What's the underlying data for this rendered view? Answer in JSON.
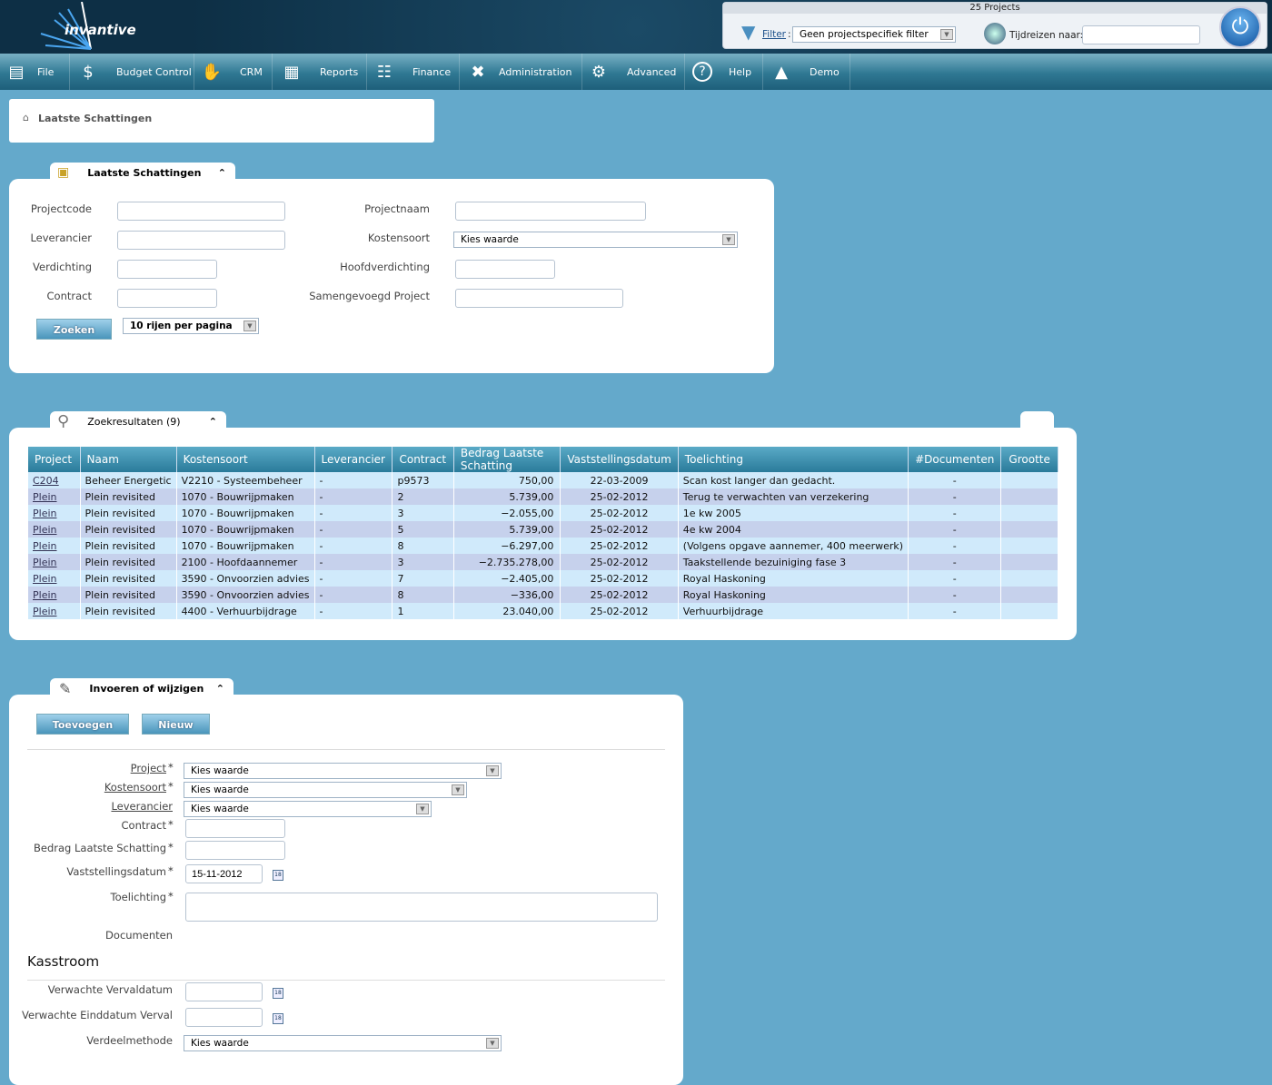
{
  "app": {
    "logo": "invantive",
    "colors": {
      "accent": "#2a7b9a",
      "background": "#64a9cb"
    }
  },
  "toppanel": {
    "projects_count": "25 Projects",
    "filter_label": "Filter",
    "filter_value": "Geen projectspecifiek filter",
    "timetravel_label": "Tijdreizen naar:",
    "timetravel_value": ""
  },
  "menu": [
    {
      "label": "File",
      "icon": "cabinet-icon"
    },
    {
      "label": "Budget Control",
      "icon": "money-bag-icon"
    },
    {
      "label": "CRM",
      "icon": "handshake-icon"
    },
    {
      "label": "Reports",
      "icon": "presentation-icon"
    },
    {
      "label": "Finance",
      "icon": "calculator-icon"
    },
    {
      "label": "Administration",
      "icon": "tools-icon"
    },
    {
      "label": "Advanced",
      "icon": "gears-icon"
    },
    {
      "label": "Help",
      "icon": "help-icon"
    },
    {
      "label": "Demo",
      "icon": "demo-icon"
    }
  ],
  "breadcrumb": "Laatste Schattingen",
  "search": {
    "title": "Laatste Schattingen",
    "labels": {
      "projectcode": "Projectcode",
      "leverancier": "Leverancier",
      "verdichting": "Verdichting",
      "contract": "Contract",
      "projectnaam": "Projectnaam",
      "kostensoort": "Kostensoort",
      "hoofdverdichting": "Hoofdverdichting",
      "samengevoegd": "Samengevoegd Project"
    },
    "kostensoort_value": "Kies waarde",
    "search_button": "Zoeken",
    "rows_per_page": "10 rijen per pagina"
  },
  "results": {
    "title": "Zoekresultaten (9)",
    "columns": [
      "Project",
      "Naam",
      "Kostensoort",
      "Leverancier",
      "Contract",
      "Bedrag Laatste Schatting",
      "Vaststellingsdatum",
      "Toelichting",
      "#Documenten",
      "Grootte"
    ],
    "rows": [
      [
        "C204",
        "Beheer Energetic",
        "V2210 - Systeembeheer",
        "-",
        "p9573",
        "750,00",
        "22-03-2009",
        "Scan kost langer dan gedacht.",
        "-",
        ""
      ],
      [
        "Plein",
        "Plein revisited",
        "1070 - Bouwrijpmaken",
        "-",
        "2",
        "5.739,00",
        "25-02-2012",
        "Terug te verwachten van verzekering",
        "-",
        ""
      ],
      [
        "Plein",
        "Plein revisited",
        "1070 - Bouwrijpmaken",
        "-",
        "3",
        "−2.055,00",
        "25-02-2012",
        "1e kw 2005",
        "-",
        ""
      ],
      [
        "Plein",
        "Plein revisited",
        "1070 - Bouwrijpmaken",
        "-",
        "5",
        "5.739,00",
        "25-02-2012",
        "4e kw 2004",
        "-",
        ""
      ],
      [
        "Plein",
        "Plein revisited",
        "1070 - Bouwrijpmaken",
        "-",
        "8",
        "−6.297,00",
        "25-02-2012",
        "(Volgens opgave aannemer, 400 meerwerk)",
        "-",
        ""
      ],
      [
        "Plein",
        "Plein revisited",
        "2100 - Hoofdaannemer",
        "-",
        "3",
        "−2.735.278,00",
        "25-02-2012",
        "Taakstellende bezuiniging fase 3",
        "-",
        ""
      ],
      [
        "Plein",
        "Plein revisited",
        "3590 - Onvoorzien advies",
        "-",
        "7",
        "−2.405,00",
        "25-02-2012",
        "Royal Haskoning",
        "-",
        ""
      ],
      [
        "Plein",
        "Plein revisited",
        "3590 - Onvoorzien advies",
        "-",
        "8",
        "−336,00",
        "25-02-2012",
        "Royal Haskoning",
        "-",
        ""
      ],
      [
        "Plein",
        "Plein revisited",
        "4400 - Verhuurbijdrage",
        "-",
        "1",
        "23.040,00",
        "25-02-2012",
        "Verhuurbijdrage",
        "-",
        ""
      ]
    ]
  },
  "edit": {
    "title": "Invoeren of wijzigen",
    "add_button": "Toevoegen",
    "new_button": "Nieuw",
    "labels": {
      "project": "Project",
      "kostensoort": "Kostensoort",
      "leverancier": "Leverancier",
      "contract": "Contract",
      "bedrag": "Bedrag Laatste Schatting",
      "datum": "Vaststellingsdatum",
      "toelichting": "Toelichting",
      "documenten": "Documenten"
    },
    "required": "*",
    "select_placeholder": "Kies waarde",
    "datum_value": "15-11-2012",
    "kasstroom": {
      "title": "Kasstroom",
      "verval": "Verwachte Vervaldatum",
      "einddatum": "Verwachte Einddatum Verval",
      "verdeel": "Verdeelmethode"
    }
  }
}
